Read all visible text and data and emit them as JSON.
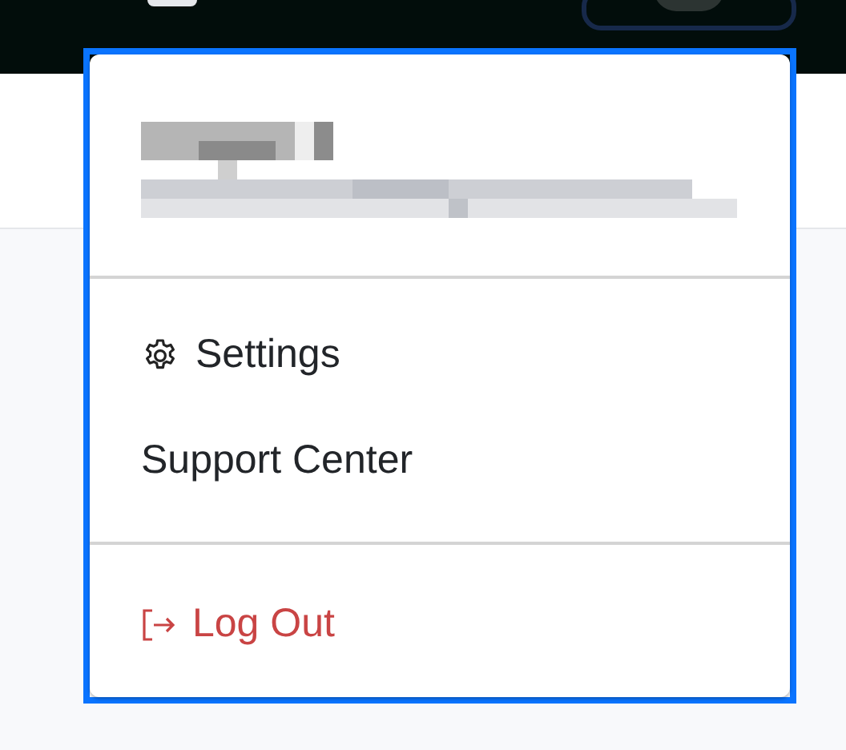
{
  "menu": {
    "sections": [
      {
        "items": [
          {
            "label": "Settings",
            "kind": "gear"
          },
          {
            "label": "Support Center",
            "kind": "plain"
          }
        ]
      },
      {
        "items": [
          {
            "label": "Log Out",
            "kind": "logout"
          }
        ]
      }
    ]
  }
}
